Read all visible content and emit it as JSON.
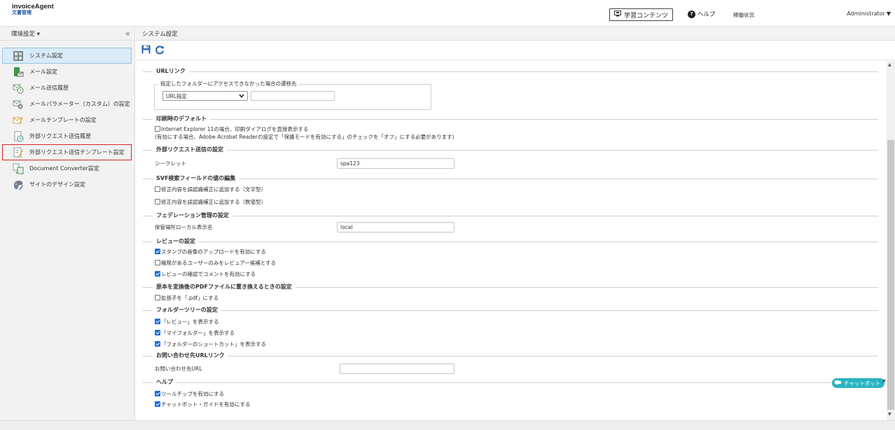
{
  "header": {
    "logo_main": "invoiceAgent",
    "logo_sub": "文書管理",
    "learn_button": "学習コンテンツ",
    "help_label": "ヘルプ",
    "status_label": "稼働状況",
    "user_label": "Administrator"
  },
  "sidebar": {
    "title": "環境設定",
    "items": [
      {
        "label": "システム設定",
        "icon": "system-settings-icon"
      },
      {
        "label": "メール設定",
        "icon": "mail-settings-icon"
      },
      {
        "label": "メール送信履歴",
        "icon": "mail-history-icon"
      },
      {
        "label": "メールパラメーター（カスタム）の設定",
        "icon": "mail-parameter-icon"
      },
      {
        "label": "メールテンプレートの設定",
        "icon": "mail-template-icon"
      },
      {
        "label": "外部リクエスト送信履歴",
        "icon": "request-history-icon"
      },
      {
        "label": "外部リクエスト送信テンプレート設定",
        "icon": "request-template-icon"
      },
      {
        "label": "Document Converter設定",
        "icon": "document-converter-icon"
      },
      {
        "label": "サイトのデザイン設定",
        "icon": "site-design-icon"
      }
    ]
  },
  "breadcrumb": "システム設定",
  "toolbar": {
    "save": "save-icon",
    "refresh": "refresh-icon"
  },
  "sections": {
    "url_link": {
      "title": "URLリンク",
      "fieldset_label": "指定したフォルダーにアクセスできなかった場合の遷移先",
      "select_value": "URL指定",
      "url_value": ""
    },
    "print_default": {
      "title": "印刷時のデフォルト",
      "checkbox_label": "Internet Explorer 11の場合、印刷ダイアログを直接表示する",
      "note": "(有効にする場合、Adobe Acrobat Readerの設定で「保護モードを有効にする」のチェックを「オフ」にする必要があります)"
    },
    "external_request": {
      "title": "外部リクエスト送信の設定",
      "secret_label": "シークレット",
      "secret_value": "spa123"
    },
    "svf": {
      "title": "SVF検索フィールドの値の編集",
      "cb1": "修正内容を誤認識補正に追加する（文字型）",
      "cb2": "修正内容を誤認識補正に追加する（数値型）"
    },
    "federation": {
      "title": "フェデレーション管理の設定",
      "label": "保管場所ローカル表示名",
      "value": "local"
    },
    "review": {
      "title": "レビューの設定",
      "cb1": "スタンプの画像のアップロードを有効にする",
      "cb2": "権限があるユーザーのみをレビュアー候補とする",
      "cb3": "レビューの確認でコメントを有効にする"
    },
    "pdf_replace": {
      "title": "原本を変換後のPDFファイルに置き換えるときの設定",
      "cb1": "拡張子を「.pdf」にする"
    },
    "folder_tree": {
      "title": "フォルダーツリーの設定",
      "cb1": "「レビュー」を表示する",
      "cb2": "「マイフォルダー」を表示する",
      "cb3": "「フォルダーのショートカット」を表示する"
    },
    "contact": {
      "title": "お問い合わせ先URLリンク",
      "label": "お問い合わせ先URL",
      "value": ""
    },
    "help": {
      "title": "ヘルプ",
      "cb1": "ツールチップを有効にする",
      "cb2": "チャットボット・ガイドを有効にする"
    }
  },
  "chatbot_label": "チャットボット",
  "colors": {
    "accent": "#1e6fd9",
    "highlight_border": "#d9252a",
    "active_bg": "#d9ebf8",
    "chatbot": "#2bb3c0"
  }
}
